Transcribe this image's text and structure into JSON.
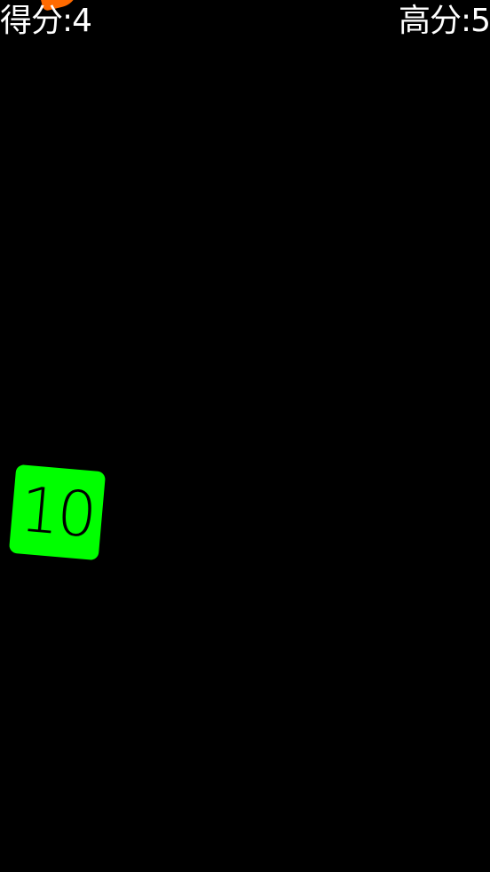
{
  "hud": {
    "score_label": "得分:4",
    "high_score_label": "高分:5"
  },
  "tile": {
    "number": "10",
    "color": "#00ff00"
  },
  "colors": {
    "background": "#000000",
    "text": "#ffffff",
    "orange_shape": "#ff6a00"
  }
}
